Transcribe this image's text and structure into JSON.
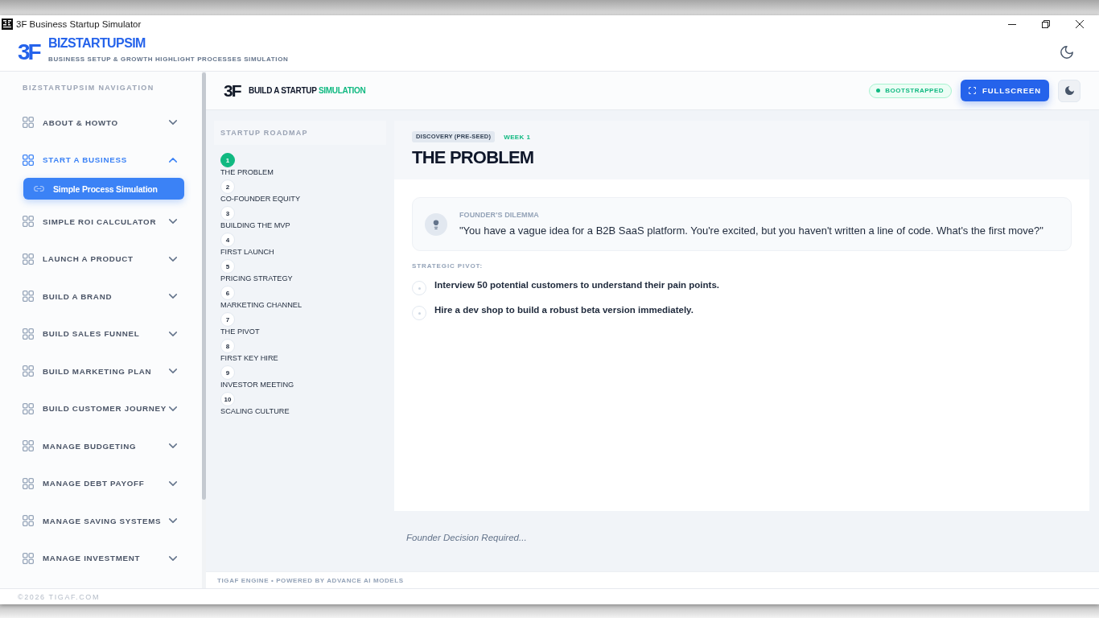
{
  "window": {
    "title": "3F Business Startup Simulator"
  },
  "app_header": {
    "logo": "3F",
    "title": "BIZSTARTUPSIM",
    "subtitle": "BUSINESS SETUP & GROWTH HIGHLIGHT PROCESSES SIMULATION"
  },
  "sidebar": {
    "heading": "BIZSTARTUPSIM NAVIGATION",
    "items": [
      {
        "label": "ABOUT & HOWTO",
        "expanded": false
      },
      {
        "label": "START A BUSINESS",
        "expanded": true,
        "children": [
          {
            "label": "Simple Process Simulation",
            "selected": true
          }
        ]
      },
      {
        "label": "SIMPLE ROI CALCULATOR",
        "expanded": false
      },
      {
        "label": "LAUNCH A PRODUCT",
        "expanded": false
      },
      {
        "label": "BUILD A BRAND",
        "expanded": false
      },
      {
        "label": "BUILD SALES FUNNEL",
        "expanded": false
      },
      {
        "label": "BUILD MARKETING PLAN",
        "expanded": false
      },
      {
        "label": "BUILD CUSTOMER JOURNEY",
        "expanded": false
      },
      {
        "label": "MANAGE BUDGETING",
        "expanded": false
      },
      {
        "label": "MANAGE DEBT PAYOFF",
        "expanded": false
      },
      {
        "label": "MANAGE SAVING SYSTEMS",
        "expanded": false
      },
      {
        "label": "MANAGE INVESTMENT",
        "expanded": false
      }
    ]
  },
  "toolbar": {
    "logo": "3F",
    "title": "BUILD A STARTUP",
    "title_highlight": "SIMULATION",
    "badge": "BOOTSTRAPPED",
    "fullscreen_button": "FULLSCREEN"
  },
  "roadmap": {
    "heading": "STARTUP ROADMAP",
    "steps": [
      {
        "number": "1",
        "label": "THE PROBLEM",
        "selected": true
      },
      {
        "number": "2",
        "label": "CO-FOUNDER EQUITY",
        "selected": false
      },
      {
        "number": "3",
        "label": "BUILDING THE MVP",
        "selected": false
      },
      {
        "number": "4",
        "label": "FIRST LAUNCH",
        "selected": false
      },
      {
        "number": "5",
        "label": "PRICING STRATEGY",
        "selected": false
      },
      {
        "number": "6",
        "label": "MARKETING CHANNEL",
        "selected": false
      },
      {
        "number": "7",
        "label": "THE PIVOT",
        "selected": false
      },
      {
        "number": "8",
        "label": "FIRST KEY HIRE",
        "selected": false
      },
      {
        "number": "9",
        "label": "INVESTOR MEETING",
        "selected": false
      },
      {
        "number": "10",
        "label": "SCALING CULTURE",
        "selected": false
      }
    ]
  },
  "scenario": {
    "stage": "DISCOVERY (PRE-SEED)",
    "week": "WEEK 1",
    "title": "THE PROBLEM",
    "dilemma": {
      "label": "FOUNDER'S DILEMMA",
      "text": "\"You have a vague idea for a B2B SaaS platform. You're excited, but you haven't written a line of code. What's the first move?\""
    },
    "options_heading": "STRATEGIC PIVOT:",
    "options": [
      {
        "text": "Interview 50 potential customers to understand their pain points.",
        "selected": false
      },
      {
        "text": "Hire a dev shop to build a robust beta version immediately.",
        "selected": false
      }
    ],
    "status": "Founder Decision Required..."
  },
  "engine_footer": "TIGAF ENGINE • POWERED BY ADVANCE AI MODELS",
  "copyright": "©2026 TIGAF.COM"
}
